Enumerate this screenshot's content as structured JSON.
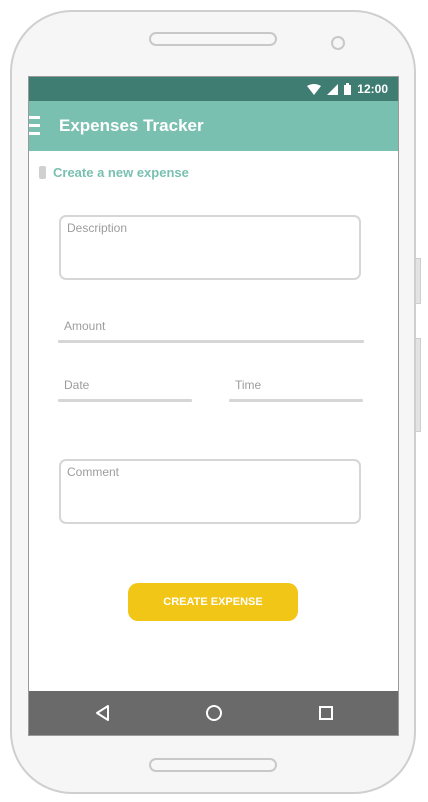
{
  "status_bar": {
    "time": "12:00"
  },
  "app_bar": {
    "title": "Expenses Tracker"
  },
  "section": {
    "title": "Create a new expense"
  },
  "form": {
    "description": {
      "placeholder": "Description",
      "value": ""
    },
    "amount": {
      "placeholder": "Amount",
      "value": ""
    },
    "date": {
      "placeholder": "Date",
      "value": ""
    },
    "time": {
      "placeholder": "Time",
      "value": ""
    },
    "comment": {
      "placeholder": "Comment",
      "value": ""
    }
  },
  "actions": {
    "create_label": "CREATE EXPENSE"
  },
  "colors": {
    "status_bar": "#3f7d72",
    "app_bar": "#7ac0b1",
    "accent_text": "#7ac0b1",
    "button": "#f1c617",
    "nav_bar": "#6a6a6a"
  },
  "icons": {
    "status": [
      "wifi-icon",
      "cell-signal-icon",
      "battery-icon"
    ],
    "menu": "menu-icon",
    "nav": [
      "back-icon",
      "home-icon",
      "recents-icon"
    ]
  }
}
